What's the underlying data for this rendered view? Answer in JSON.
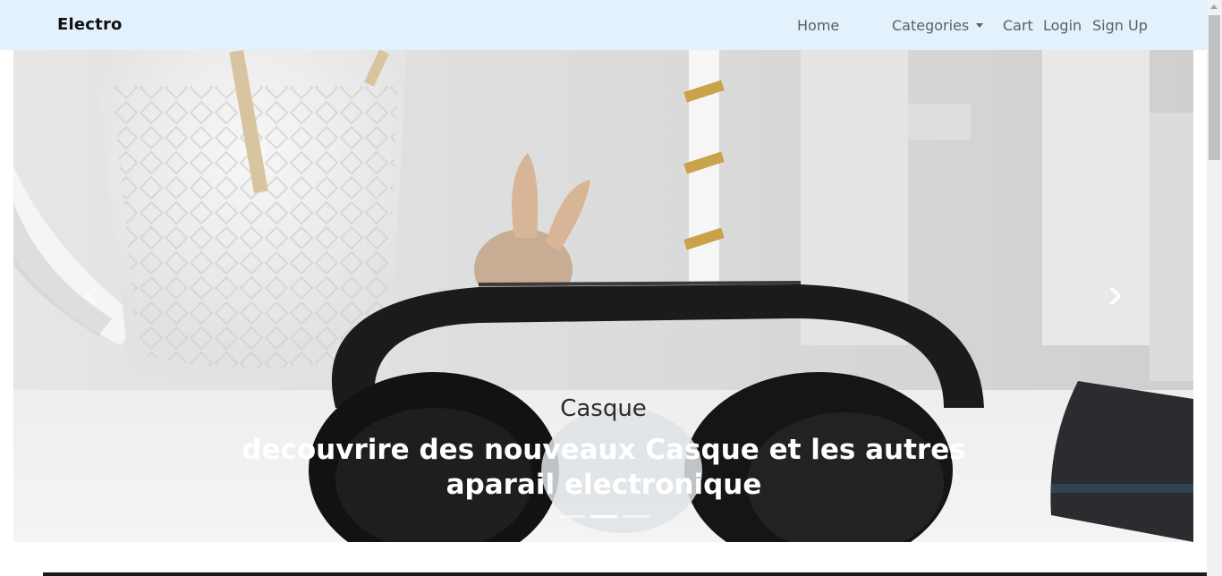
{
  "navbar": {
    "brand": "Electro",
    "links": {
      "home": "Home",
      "categories": "Categories",
      "cart": "Cart",
      "login": "Login",
      "signup": "Sign Up"
    }
  },
  "carousel": {
    "active_slide": 2,
    "slide_count": 3,
    "caption_title": "Casque",
    "caption_text": "decouvrire des nouveaux Casque et les autres aparail electronique",
    "prev_icon": "chevron-left-icon",
    "next_icon": "chevron-right-icon"
  },
  "colors": {
    "navbar_bg": "#e3f1fc",
    "nav_link": "#5a5f66",
    "brand": "#111111",
    "caption_title": "#2b2b2b",
    "caption_text": "#ffffff"
  }
}
